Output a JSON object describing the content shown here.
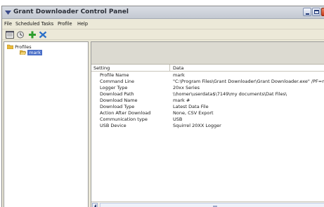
{
  "window": {
    "title": "Grant Downloader Control Panel"
  },
  "menu": [
    "File",
    "Scheduled Tasks",
    "Profile",
    "Help"
  ],
  "toolbar": {
    "buttons": [
      {
        "icon": "properties-icon"
      },
      {
        "icon": "schedule-icon"
      },
      {
        "icon": "add-icon"
      },
      {
        "icon": "delete-icon"
      }
    ]
  },
  "tree": {
    "root_label": "Profiles",
    "child_label": "mark"
  },
  "table": {
    "headers": {
      "setting": "Setting",
      "data": "Data"
    },
    "rows": [
      {
        "setting": "Profile Name",
        "data": "mark"
      },
      {
        "setting": "Command Line",
        "data": "\"C:\\Program Files\\Grant Downloader\\Grant Downloader.exe\" /PF=mark"
      },
      {
        "setting": "Logger Type",
        "data": "20xx Series"
      },
      {
        "setting": "Download Path",
        "data": "\\\\homer\\userdata$\\7149\\my documents\\Dat Files\\"
      },
      {
        "setting": "Download Name",
        "data": "mark #"
      },
      {
        "setting": "Download Type",
        "data": "Latest Data File"
      },
      {
        "setting": "Action After Download",
        "data": "None, CSV Export"
      },
      {
        "setting": "Communication type",
        "data": "USB"
      },
      {
        "setting": "USB Device",
        "data": "Squirrel 20XX Logger"
      }
    ]
  },
  "colors": {
    "add": "#2e9e2e",
    "delete": "#2a6fc8",
    "selection": "#4a6fc8"
  }
}
